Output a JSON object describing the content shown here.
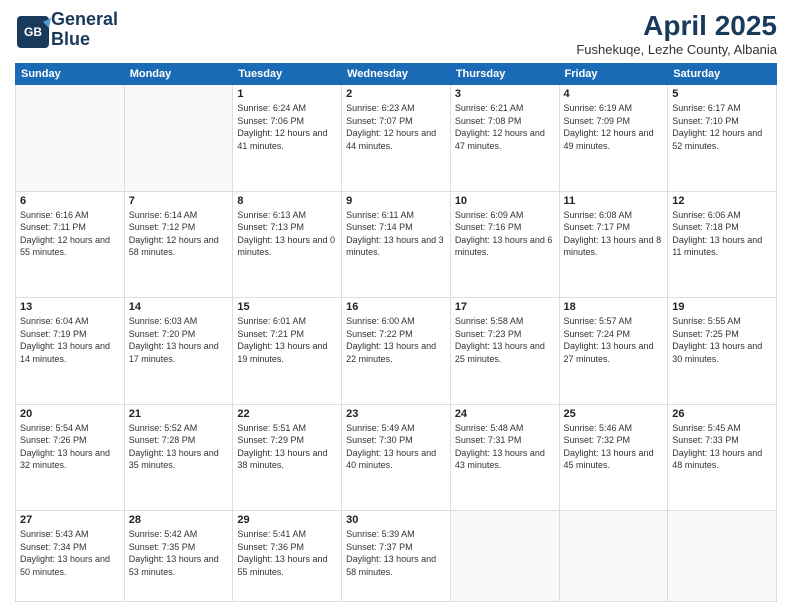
{
  "header": {
    "logo_line1": "General",
    "logo_line2": "Blue",
    "month": "April 2025",
    "location": "Fushekuqe, Lezhe County, Albania"
  },
  "weekdays": [
    "Sunday",
    "Monday",
    "Tuesday",
    "Wednesday",
    "Thursday",
    "Friday",
    "Saturday"
  ],
  "weeks": [
    [
      {
        "day": "",
        "info": ""
      },
      {
        "day": "",
        "info": ""
      },
      {
        "day": "1",
        "info": "Sunrise: 6:24 AM\nSunset: 7:06 PM\nDaylight: 12 hours and 41 minutes."
      },
      {
        "day": "2",
        "info": "Sunrise: 6:23 AM\nSunset: 7:07 PM\nDaylight: 12 hours and 44 minutes."
      },
      {
        "day": "3",
        "info": "Sunrise: 6:21 AM\nSunset: 7:08 PM\nDaylight: 12 hours and 47 minutes."
      },
      {
        "day": "4",
        "info": "Sunrise: 6:19 AM\nSunset: 7:09 PM\nDaylight: 12 hours and 49 minutes."
      },
      {
        "day": "5",
        "info": "Sunrise: 6:17 AM\nSunset: 7:10 PM\nDaylight: 12 hours and 52 minutes."
      }
    ],
    [
      {
        "day": "6",
        "info": "Sunrise: 6:16 AM\nSunset: 7:11 PM\nDaylight: 12 hours and 55 minutes."
      },
      {
        "day": "7",
        "info": "Sunrise: 6:14 AM\nSunset: 7:12 PM\nDaylight: 12 hours and 58 minutes."
      },
      {
        "day": "8",
        "info": "Sunrise: 6:13 AM\nSunset: 7:13 PM\nDaylight: 13 hours and 0 minutes."
      },
      {
        "day": "9",
        "info": "Sunrise: 6:11 AM\nSunset: 7:14 PM\nDaylight: 13 hours and 3 minutes."
      },
      {
        "day": "10",
        "info": "Sunrise: 6:09 AM\nSunset: 7:16 PM\nDaylight: 13 hours and 6 minutes."
      },
      {
        "day": "11",
        "info": "Sunrise: 6:08 AM\nSunset: 7:17 PM\nDaylight: 13 hours and 8 minutes."
      },
      {
        "day": "12",
        "info": "Sunrise: 6:06 AM\nSunset: 7:18 PM\nDaylight: 13 hours and 11 minutes."
      }
    ],
    [
      {
        "day": "13",
        "info": "Sunrise: 6:04 AM\nSunset: 7:19 PM\nDaylight: 13 hours and 14 minutes."
      },
      {
        "day": "14",
        "info": "Sunrise: 6:03 AM\nSunset: 7:20 PM\nDaylight: 13 hours and 17 minutes."
      },
      {
        "day": "15",
        "info": "Sunrise: 6:01 AM\nSunset: 7:21 PM\nDaylight: 13 hours and 19 minutes."
      },
      {
        "day": "16",
        "info": "Sunrise: 6:00 AM\nSunset: 7:22 PM\nDaylight: 13 hours and 22 minutes."
      },
      {
        "day": "17",
        "info": "Sunrise: 5:58 AM\nSunset: 7:23 PM\nDaylight: 13 hours and 25 minutes."
      },
      {
        "day": "18",
        "info": "Sunrise: 5:57 AM\nSunset: 7:24 PM\nDaylight: 13 hours and 27 minutes."
      },
      {
        "day": "19",
        "info": "Sunrise: 5:55 AM\nSunset: 7:25 PM\nDaylight: 13 hours and 30 minutes."
      }
    ],
    [
      {
        "day": "20",
        "info": "Sunrise: 5:54 AM\nSunset: 7:26 PM\nDaylight: 13 hours and 32 minutes."
      },
      {
        "day": "21",
        "info": "Sunrise: 5:52 AM\nSunset: 7:28 PM\nDaylight: 13 hours and 35 minutes."
      },
      {
        "day": "22",
        "info": "Sunrise: 5:51 AM\nSunset: 7:29 PM\nDaylight: 13 hours and 38 minutes."
      },
      {
        "day": "23",
        "info": "Sunrise: 5:49 AM\nSunset: 7:30 PM\nDaylight: 13 hours and 40 minutes."
      },
      {
        "day": "24",
        "info": "Sunrise: 5:48 AM\nSunset: 7:31 PM\nDaylight: 13 hours and 43 minutes."
      },
      {
        "day": "25",
        "info": "Sunrise: 5:46 AM\nSunset: 7:32 PM\nDaylight: 13 hours and 45 minutes."
      },
      {
        "day": "26",
        "info": "Sunrise: 5:45 AM\nSunset: 7:33 PM\nDaylight: 13 hours and 48 minutes."
      }
    ],
    [
      {
        "day": "27",
        "info": "Sunrise: 5:43 AM\nSunset: 7:34 PM\nDaylight: 13 hours and 50 minutes."
      },
      {
        "day": "28",
        "info": "Sunrise: 5:42 AM\nSunset: 7:35 PM\nDaylight: 13 hours and 53 minutes."
      },
      {
        "day": "29",
        "info": "Sunrise: 5:41 AM\nSunset: 7:36 PM\nDaylight: 13 hours and 55 minutes."
      },
      {
        "day": "30",
        "info": "Sunrise: 5:39 AM\nSunset: 7:37 PM\nDaylight: 13 hours and 58 minutes."
      },
      {
        "day": "",
        "info": ""
      },
      {
        "day": "",
        "info": ""
      },
      {
        "day": "",
        "info": ""
      }
    ]
  ]
}
